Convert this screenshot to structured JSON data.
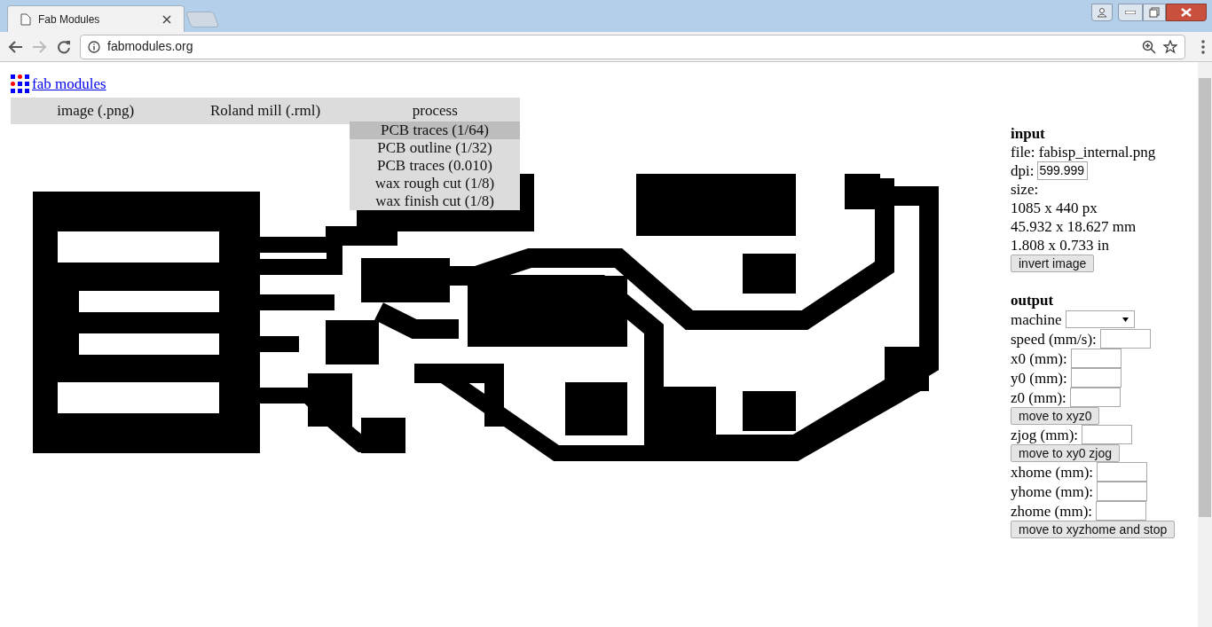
{
  "browser": {
    "tabs": [
      {
        "title": "Fab Modules",
        "selected": true
      }
    ],
    "address": "fabmodules.org"
  },
  "page": {
    "logo_link": "fab modules",
    "menu": [
      {
        "label": "image (.png)"
      },
      {
        "label": "Roland mill (.rml)"
      },
      {
        "label": "process"
      }
    ],
    "process_menu": [
      {
        "label": "PCB traces (1/64)",
        "selected": true
      },
      {
        "label": "PCB outline (1/32)",
        "selected": false
      },
      {
        "label": "PCB traces (0.010)",
        "selected": false
      },
      {
        "label": "wax rough cut (1/8)",
        "selected": false
      },
      {
        "label": "wax finish cut (1/8)",
        "selected": false
      }
    ],
    "input": {
      "heading": "input",
      "file": "file: fabisp_internal.png",
      "dpi_label": "dpi:",
      "dpi_value": "599.999",
      "size_label": "size:",
      "size_lines": [
        "1085 x 440 px",
        "45.932 x 18.627 mm",
        "1.808 x 0.733 in"
      ],
      "button": "invert image"
    },
    "output": {
      "heading": "output",
      "rows": [
        {
          "kind": "select",
          "label": "machine"
        },
        {
          "kind": "field",
          "label": "speed (mm/s):"
        },
        {
          "kind": "field",
          "label": "x0 (mm):"
        },
        {
          "kind": "field",
          "label": "y0 (mm):"
        },
        {
          "kind": "field",
          "label": "z0 (mm):"
        },
        {
          "kind": "button",
          "label": "move to xyz0"
        },
        {
          "kind": "field",
          "label": "zjog (mm):"
        },
        {
          "kind": "button",
          "label": "move to xy0 zjog"
        },
        {
          "kind": "field",
          "label": "xhome (mm):"
        },
        {
          "kind": "field",
          "label": "yhome (mm):"
        },
        {
          "kind": "field",
          "label": "zhome (mm):"
        },
        {
          "kind": "button",
          "label": "move to xyzhome and stop"
        }
      ]
    }
  }
}
